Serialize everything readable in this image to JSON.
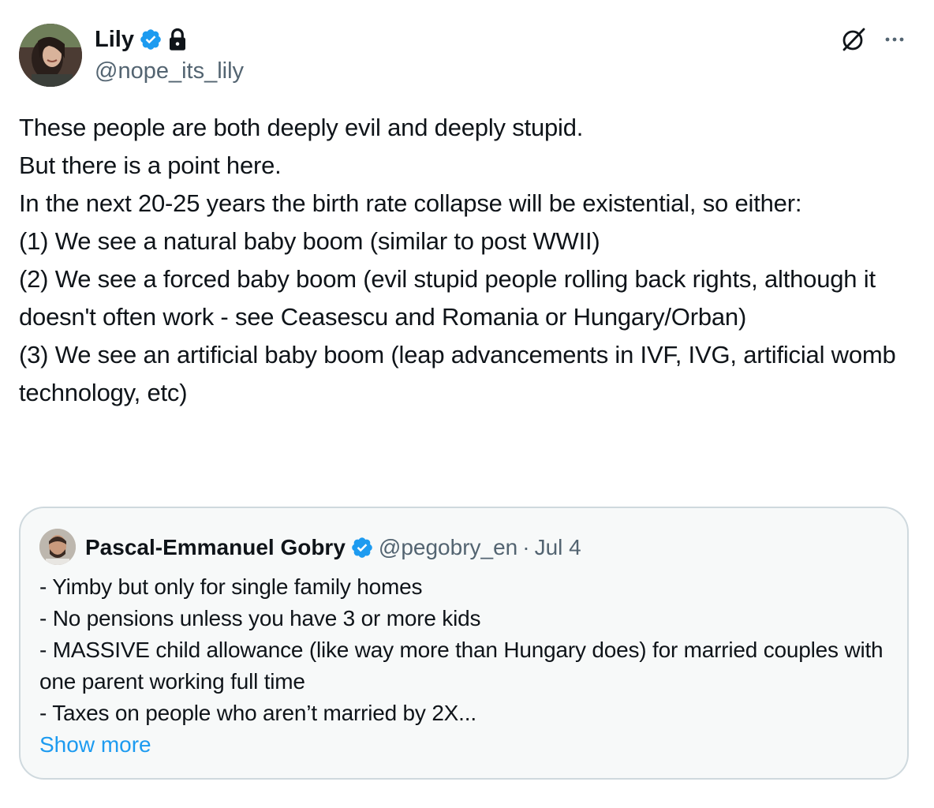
{
  "author": {
    "display_name": "Lily",
    "handle": "@nope_its_lily",
    "verified": true,
    "protected": true
  },
  "tweet": {
    "text": "These people are both deeply evil and deeply stupid.\nBut there is a point here.\nIn the next 20-25 years the birth rate collapse will be existential, so either:\n(1) We see a natural baby boom (similar to post WWII)\n(2) We see a forced baby boom (evil stupid people rolling back rights, although it doesn't often work - see Ceasescu and Romania or Hungary/Orban)\n(3) We see an artificial baby boom (leap advancements in IVF, IVG, artificial womb technology, etc)"
  },
  "quote": {
    "display_name": "Pascal-Emmanuel Gobry",
    "handle": "@pegobry_en",
    "separator": "·",
    "date": "Jul 4",
    "verified": true,
    "text": "- Yimby but only for single family homes\n- No pensions unless you have 3 or more kids\n- MASSIVE child allowance (like way more than Hungary does) for married couples with one parent working full time\n- Taxes on people who aren’t married by 2X...",
    "show_more_label": "Show more"
  },
  "icons": {
    "verified": "verified-badge-icon",
    "lock": "lock-icon",
    "grok": "grok-icon",
    "more": "more-options-icon"
  },
  "colors": {
    "verified_blue": "#1d9bf0",
    "link_blue": "#1d9bf0",
    "secondary_text": "#536471",
    "primary_text": "#0f1419",
    "quote_border": "#cfd9de",
    "quote_bg": "#f7f9f9"
  }
}
